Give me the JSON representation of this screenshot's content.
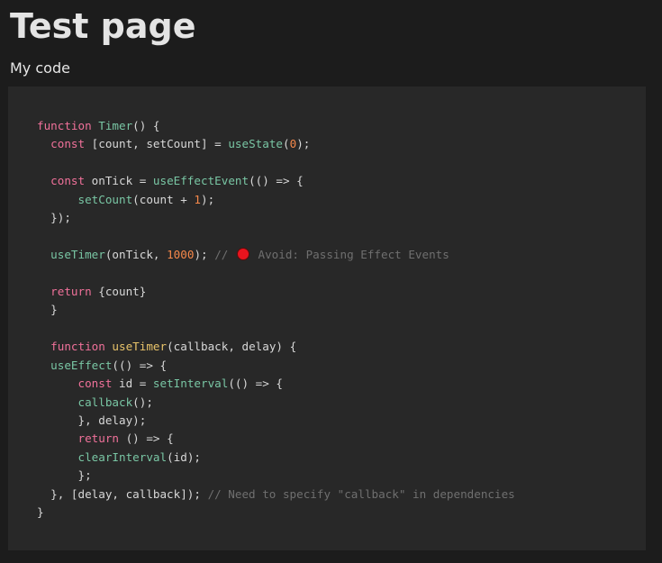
{
  "page": {
    "title": "Test page",
    "section_label": "My code"
  },
  "code": {
    "lines": [
      [
        {
          "t": "function ",
          "c": "keyword"
        },
        {
          "t": "Timer",
          "c": "fn"
        },
        {
          "t": "() {",
          "c": "plain"
        }
      ],
      [
        {
          "t": "  ",
          "c": "plain"
        },
        {
          "t": "const ",
          "c": "keyword"
        },
        {
          "t": "[count, setCount] = ",
          "c": "plain"
        },
        {
          "t": "useState",
          "c": "fn"
        },
        {
          "t": "(",
          "c": "plain"
        },
        {
          "t": "0",
          "c": "num"
        },
        {
          "t": ");",
          "c": "plain"
        }
      ],
      [],
      [
        {
          "t": "  ",
          "c": "plain"
        },
        {
          "t": "const ",
          "c": "keyword"
        },
        {
          "t": "onTick = ",
          "c": "plain"
        },
        {
          "t": "useEffectEvent",
          "c": "fn"
        },
        {
          "t": "(() => {",
          "c": "plain"
        }
      ],
      [
        {
          "t": "      ",
          "c": "plain"
        },
        {
          "t": "setCount",
          "c": "fn"
        },
        {
          "t": "(count + ",
          "c": "plain"
        },
        {
          "t": "1",
          "c": "num"
        },
        {
          "t": ");",
          "c": "plain"
        }
      ],
      [
        {
          "t": "  });",
          "c": "plain"
        }
      ],
      [],
      [
        {
          "t": "  ",
          "c": "plain"
        },
        {
          "t": "useTimer",
          "c": "fn"
        },
        {
          "t": "(onTick, ",
          "c": "plain"
        },
        {
          "t": "1000",
          "c": "num"
        },
        {
          "t": "); ",
          "c": "plain"
        },
        {
          "t": "// ",
          "c": "comment"
        },
        {
          "t": "",
          "c": "dot"
        },
        {
          "t": " Avoid: Passing Effect Events",
          "c": "comment"
        }
      ],
      [],
      [
        {
          "t": "  ",
          "c": "plain"
        },
        {
          "t": "return ",
          "c": "keyword"
        },
        {
          "t": "{count}",
          "c": "plain"
        }
      ],
      [
        {
          "t": "  }",
          "c": "plain"
        }
      ],
      [],
      [
        {
          "t": "  ",
          "c": "plain"
        },
        {
          "t": "function ",
          "c": "keyword"
        },
        {
          "t": "useTimer",
          "c": "decl"
        },
        {
          "t": "(callback, delay) {",
          "c": "plain"
        }
      ],
      [
        {
          "t": "  ",
          "c": "plain"
        },
        {
          "t": "useEffect",
          "c": "fn"
        },
        {
          "t": "(() => {",
          "c": "plain"
        }
      ],
      [
        {
          "t": "      ",
          "c": "plain"
        },
        {
          "t": "const ",
          "c": "keyword"
        },
        {
          "t": "id = ",
          "c": "plain"
        },
        {
          "t": "setInterval",
          "c": "fn"
        },
        {
          "t": "(() => {",
          "c": "plain"
        }
      ],
      [
        {
          "t": "      ",
          "c": "plain"
        },
        {
          "t": "callback",
          "c": "fn"
        },
        {
          "t": "();",
          "c": "plain"
        }
      ],
      [
        {
          "t": "      }, delay);",
          "c": "plain"
        }
      ],
      [
        {
          "t": "      ",
          "c": "plain"
        },
        {
          "t": "return ",
          "c": "keyword"
        },
        {
          "t": "() => {",
          "c": "plain"
        }
      ],
      [
        {
          "t": "      ",
          "c": "plain"
        },
        {
          "t": "clearInterval",
          "c": "fn"
        },
        {
          "t": "(id);",
          "c": "plain"
        }
      ],
      [
        {
          "t": "      };",
          "c": "plain"
        }
      ],
      [
        {
          "t": "  }, [delay, callback]); ",
          "c": "plain"
        },
        {
          "t": "// Need to specify \"callback\" in dependencies",
          "c": "comment"
        }
      ],
      [
        {
          "t": "}",
          "c": "plain"
        }
      ]
    ]
  },
  "status_icon": {
    "name": "error-dot-icon",
    "color": "#e8141e"
  }
}
